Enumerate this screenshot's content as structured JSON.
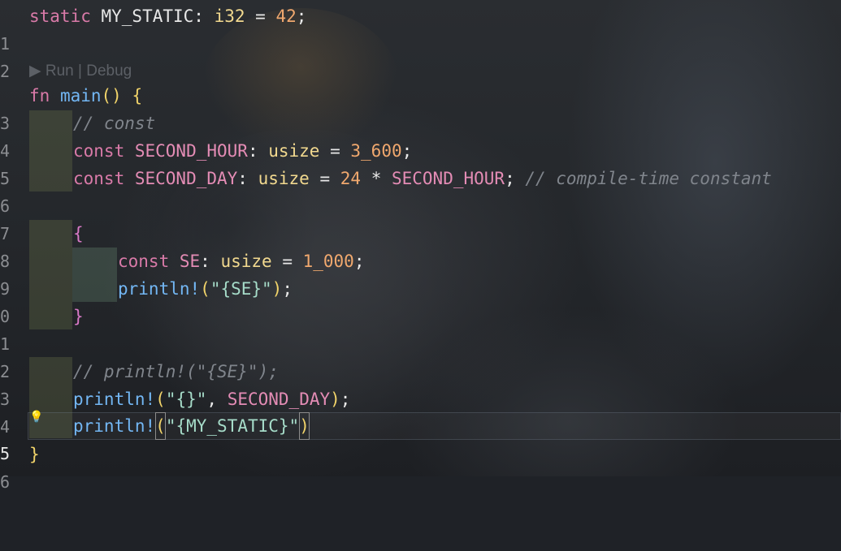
{
  "codelens": {
    "run": "▶ Run",
    "separator": " | ",
    "debug": "Debug"
  },
  "line_numbers": [
    "1",
    "2",
    "3",
    "4",
    "5",
    "6",
    "7",
    "8",
    "9",
    "0",
    "1",
    "2",
    "3",
    "4",
    "5",
    "6"
  ],
  "code": {
    "l1": {
      "kw": "static",
      "name": " MY_STATIC",
      "colon": ": ",
      "type": "i32",
      "eq": " = ",
      "val": "42",
      "end": ";"
    },
    "l3": {
      "kw": "fn",
      "name": " main",
      "parens": "()",
      "brace": " {"
    },
    "l4": {
      "comment": "// const"
    },
    "l5": {
      "kw": "const",
      "name": " SECOND_HOUR",
      "colon": ": ",
      "type": "usize",
      "eq": " = ",
      "val": "3_600",
      "end": ";"
    },
    "l6": {
      "kw": "const",
      "name": " SECOND_DAY",
      "colon": ": ",
      "type": "usize",
      "eq": " = ",
      "val": "24",
      "op": " * ",
      "ref": "SECOND_HOUR",
      "end": ";",
      "comment": " // compile-time constant"
    },
    "l8": {
      "brace": "{"
    },
    "l9": {
      "kw": "const",
      "name": " SE",
      "colon": ": ",
      "type": "usize",
      "eq": " = ",
      "val": "1_000",
      "end": ";"
    },
    "l10": {
      "fn": "println!",
      "open": "(",
      "str": "\"{SE}\"",
      "close": ")",
      "end": ";"
    },
    "l11": {
      "brace": "}"
    },
    "l13": {
      "comment": "// println!(\"{SE}\");"
    },
    "l14": {
      "fn": "println!",
      "open": "(",
      "str": "\"{}\"",
      "comma": ", ",
      "ref": "SECOND_DAY",
      "close": ")",
      "end": ";"
    },
    "l15": {
      "fn": "println!",
      "open": "(",
      "str": "\"{MY_STATIC}\"",
      "close": ")"
    },
    "l16": {
      "brace": "}"
    }
  },
  "colors": {
    "keyword": "#d97aa8",
    "function": "#73b7f4",
    "type": "#f2d98f",
    "number": "#f0a86e",
    "string": "#a6dcc9",
    "comment": "#80858c"
  },
  "icons": {
    "lightbulb": "lightbulb-icon"
  }
}
